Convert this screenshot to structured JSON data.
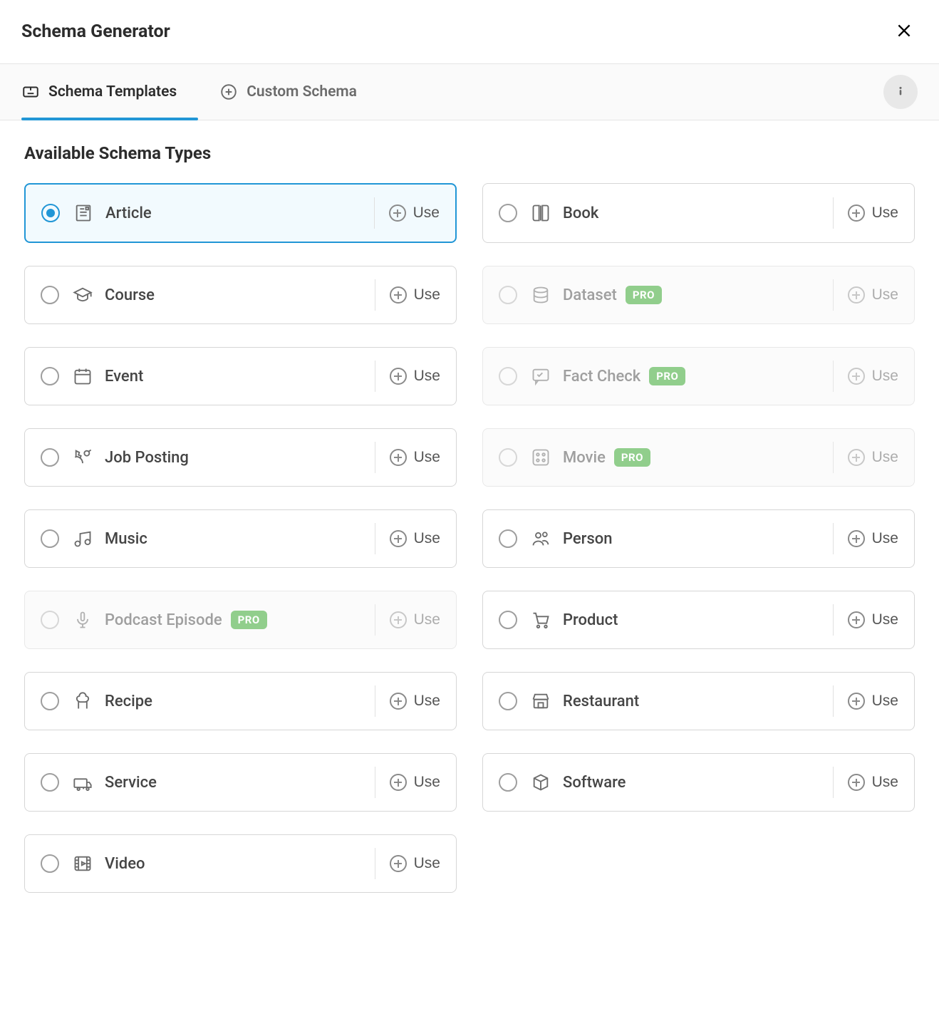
{
  "header": {
    "title": "Schema Generator"
  },
  "tabs": {
    "templates": {
      "label": "Schema Templates",
      "active": true
    },
    "custom": {
      "label": "Custom Schema",
      "active": false
    }
  },
  "section": {
    "title": "Available Schema Types"
  },
  "pro_badge": "PRO",
  "action_label": "Use",
  "schemas": {
    "article": {
      "label": "Article",
      "selected": true,
      "pro": false,
      "disabled": false,
      "icon": "article-icon"
    },
    "book": {
      "label": "Book",
      "selected": false,
      "pro": false,
      "disabled": false,
      "icon": "book-icon"
    },
    "course": {
      "label": "Course",
      "selected": false,
      "pro": false,
      "disabled": false,
      "icon": "course-icon"
    },
    "dataset": {
      "label": "Dataset",
      "selected": false,
      "pro": true,
      "disabled": true,
      "icon": "dataset-icon"
    },
    "event": {
      "label": "Event",
      "selected": false,
      "pro": false,
      "disabled": false,
      "icon": "event-icon"
    },
    "factcheck": {
      "label": "Fact Check",
      "selected": false,
      "pro": true,
      "disabled": true,
      "icon": "factcheck-icon"
    },
    "jobposting": {
      "label": "Job Posting",
      "selected": false,
      "pro": false,
      "disabled": false,
      "icon": "jobposting-icon"
    },
    "movie": {
      "label": "Movie",
      "selected": false,
      "pro": true,
      "disabled": true,
      "icon": "movie-icon"
    },
    "music": {
      "label": "Music",
      "selected": false,
      "pro": false,
      "disabled": false,
      "icon": "music-icon"
    },
    "person": {
      "label": "Person",
      "selected": false,
      "pro": false,
      "disabled": false,
      "icon": "person-icon"
    },
    "podcast": {
      "label": "Podcast Episode",
      "selected": false,
      "pro": true,
      "disabled": true,
      "icon": "podcast-icon"
    },
    "product": {
      "label": "Product",
      "selected": false,
      "pro": false,
      "disabled": false,
      "icon": "product-icon"
    },
    "recipe": {
      "label": "Recipe",
      "selected": false,
      "pro": false,
      "disabled": false,
      "icon": "recipe-icon"
    },
    "restaurant": {
      "label": "Restaurant",
      "selected": false,
      "pro": false,
      "disabled": false,
      "icon": "restaurant-icon"
    },
    "service": {
      "label": "Service",
      "selected": false,
      "pro": false,
      "disabled": false,
      "icon": "service-icon"
    },
    "software": {
      "label": "Software",
      "selected": false,
      "pro": false,
      "disabled": false,
      "icon": "software-icon"
    },
    "video": {
      "label": "Video",
      "selected": false,
      "pro": false,
      "disabled": false,
      "icon": "video-icon"
    }
  }
}
